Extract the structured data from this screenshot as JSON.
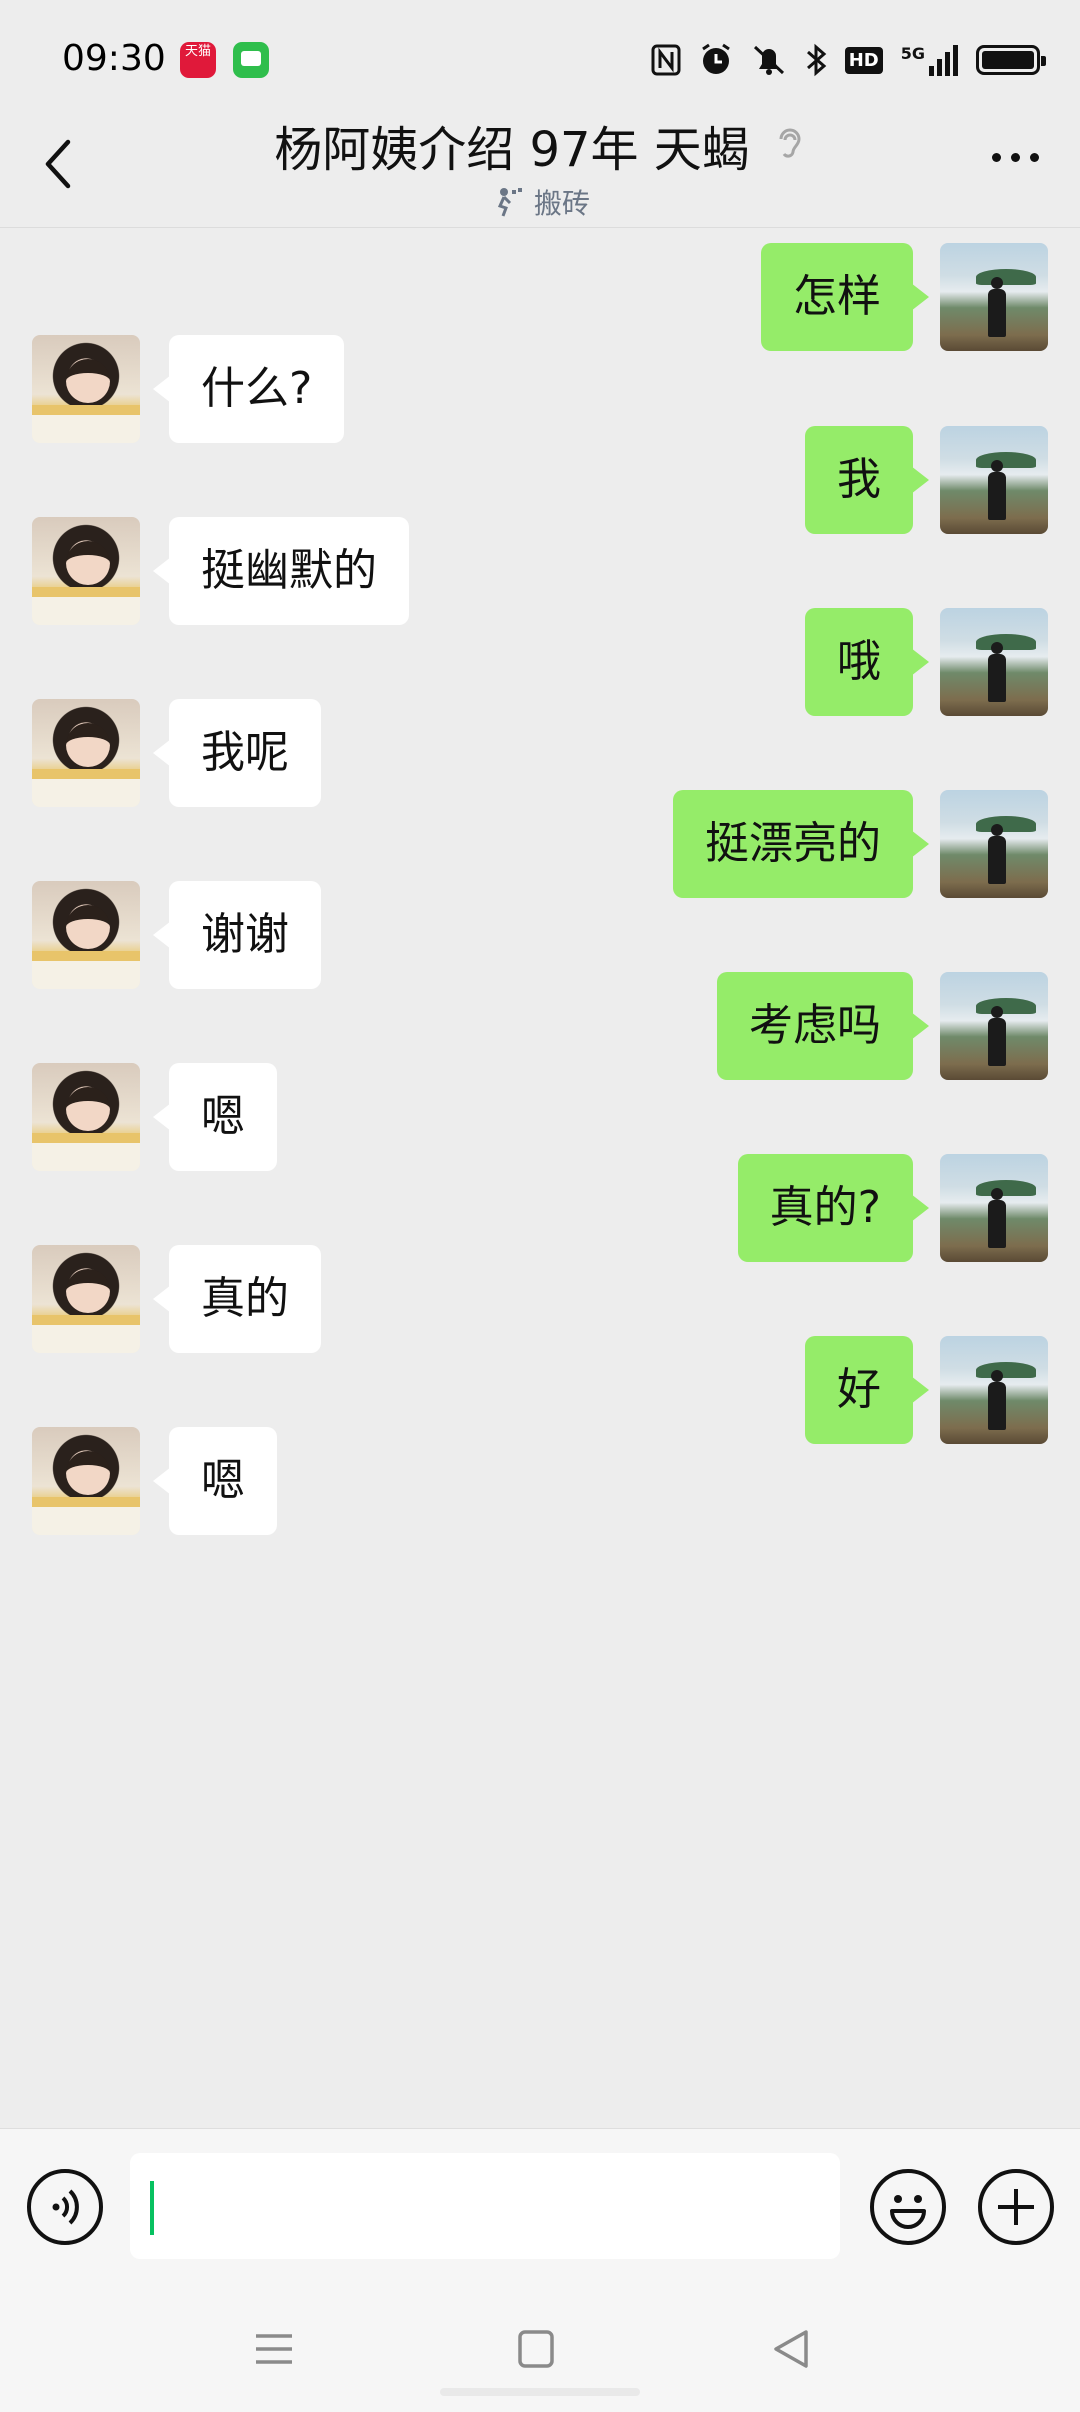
{
  "status_bar": {
    "time": "09:30",
    "tmall_badge": "天猫",
    "icons": [
      "nfc-icon",
      "alarm-icon",
      "mute-icon",
      "bluetooth-icon",
      "hd-icon",
      "signal-5g-icon",
      "battery-icon"
    ],
    "hd_label": "HD",
    "network_label": "5G"
  },
  "header": {
    "title": "杨阿姨介绍 97年 天蝎",
    "subtitle": "搬砖"
  },
  "messages": [
    {
      "from": "me",
      "text": "怎样"
    },
    {
      "from": "them",
      "text": "什么?"
    },
    {
      "from": "me",
      "text": "我"
    },
    {
      "from": "them",
      "text": "挺幽默的"
    },
    {
      "from": "me",
      "text": "哦"
    },
    {
      "from": "them",
      "text": "我呢"
    },
    {
      "from": "me",
      "text": "挺漂亮的"
    },
    {
      "from": "them",
      "text": "谢谢"
    },
    {
      "from": "me",
      "text": "考虑吗"
    },
    {
      "from": "them",
      "text": "嗯"
    },
    {
      "from": "me",
      "text": "真的?"
    },
    {
      "from": "them",
      "text": "真的"
    },
    {
      "from": "me",
      "text": "好"
    },
    {
      "from": "them",
      "text": "嗯"
    }
  ],
  "input": {
    "value": "",
    "placeholder": ""
  },
  "colors": {
    "my_bubble": "#95ec69",
    "their_bubble": "#ffffff",
    "background": "#ededed",
    "caret": "#07c160"
  }
}
